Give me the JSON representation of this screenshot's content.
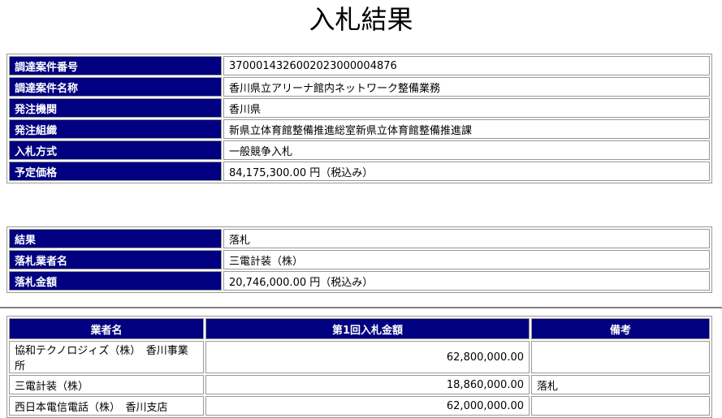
{
  "page_title": "入札結果",
  "info_table": [
    {
      "label": "調達案件番号",
      "value": "3700014326002023000004876"
    },
    {
      "label": "調達案件名称",
      "value": "香川県立アリーナ館内ネットワーク整備業務"
    },
    {
      "label": "発注機関",
      "value": "香川県"
    },
    {
      "label": "発注組織",
      "value": "新県立体育館整備推進総室新県立体育館整備推進課"
    },
    {
      "label": "入札方式",
      "value": "一般競争入札"
    },
    {
      "label": "予定価格",
      "value": "84,175,300.00 円（税込み）"
    }
  ],
  "result_table": [
    {
      "label": "結果",
      "value": "落札"
    },
    {
      "label": "落札業者名",
      "value": "三電計装（株）"
    },
    {
      "label": "落札金額",
      "value": "20,746,000.00 円（税込み）"
    }
  ],
  "bid_table": {
    "headers": [
      "業者名",
      "第1回入札金額",
      "備考"
    ],
    "rows": [
      {
        "name": "協和テクノロジィズ（株）　香川事業所",
        "amount": "62,800,000.00",
        "note": ""
      },
      {
        "name": "三電計装（株）",
        "amount": "18,860,000.00",
        "note": "落札"
      },
      {
        "name": "西日本電信電話（株）　香川支店",
        "amount": "62,000,000.00",
        "note": ""
      }
    ]
  },
  "colors": {
    "header_bg": "#000080",
    "header_text": "#ffffff",
    "border": "#999999"
  }
}
